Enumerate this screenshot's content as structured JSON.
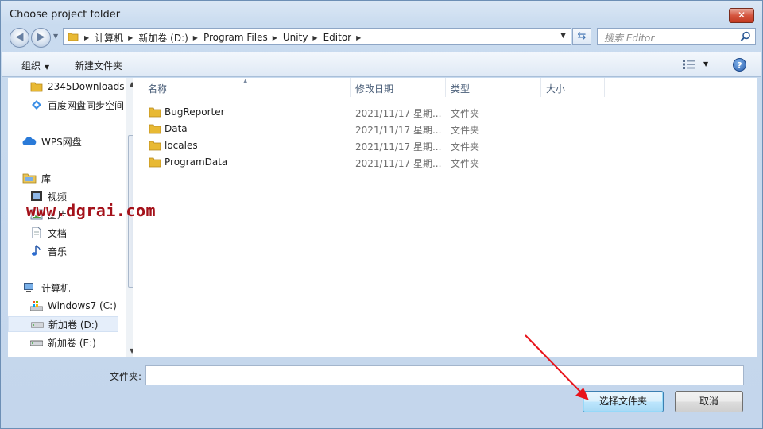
{
  "window": {
    "title": "Choose project folder",
    "close_glyph": "✕"
  },
  "address": {
    "crumbs": [
      "计算机",
      "新加卷 (D:)",
      "Program Files",
      "Unity",
      "Editor"
    ],
    "search_placeholder": "搜索 Editor"
  },
  "toolbar": {
    "organize_label": "组织",
    "new_folder_label": "新建文件夹",
    "help_glyph": "?"
  },
  "nav": {
    "items": [
      {
        "label": "2345Downloads",
        "icon": "folder-icon"
      },
      {
        "label": "百度网盘同步空间",
        "icon": "baidu-sync-icon"
      },
      {
        "label": "WPS网盘",
        "icon": "cloud-icon"
      },
      {
        "label": "库",
        "icon": "library-icon"
      },
      {
        "label": "视频",
        "icon": "video-icon"
      },
      {
        "label": "图片",
        "icon": "picture-icon"
      },
      {
        "label": "文档",
        "icon": "document-icon"
      },
      {
        "label": "音乐",
        "icon": "music-icon"
      },
      {
        "label": "计算机",
        "icon": "computer-icon"
      },
      {
        "label": "Windows7 (C:)",
        "icon": "system-drive-icon"
      },
      {
        "label": "新加卷 (D:)",
        "icon": "drive-icon"
      },
      {
        "label": "新加卷 (E:)",
        "icon": "drive-icon"
      }
    ]
  },
  "columns": {
    "name": "名称",
    "date": "修改日期",
    "type": "类型",
    "size": "大小"
  },
  "files": [
    {
      "name": "BugReporter",
      "date": "2021/11/17 星期...",
      "type": "文件夹"
    },
    {
      "name": "Data",
      "date": "2021/11/17 星期...",
      "type": "文件夹"
    },
    {
      "name": "locales",
      "date": "2021/11/17 星期...",
      "type": "文件夹"
    },
    {
      "name": "ProgramData",
      "date": "2021/11/17 星期...",
      "type": "文件夹"
    }
  ],
  "footer": {
    "folder_label": "文件夹:",
    "folder_value": "",
    "select_button": "选择文件夹",
    "cancel_button": "取消"
  },
  "watermark": "www.dgrai.com",
  "colors": {
    "annotation_arrow": "#e8141b",
    "watermark": "#a4111a"
  }
}
